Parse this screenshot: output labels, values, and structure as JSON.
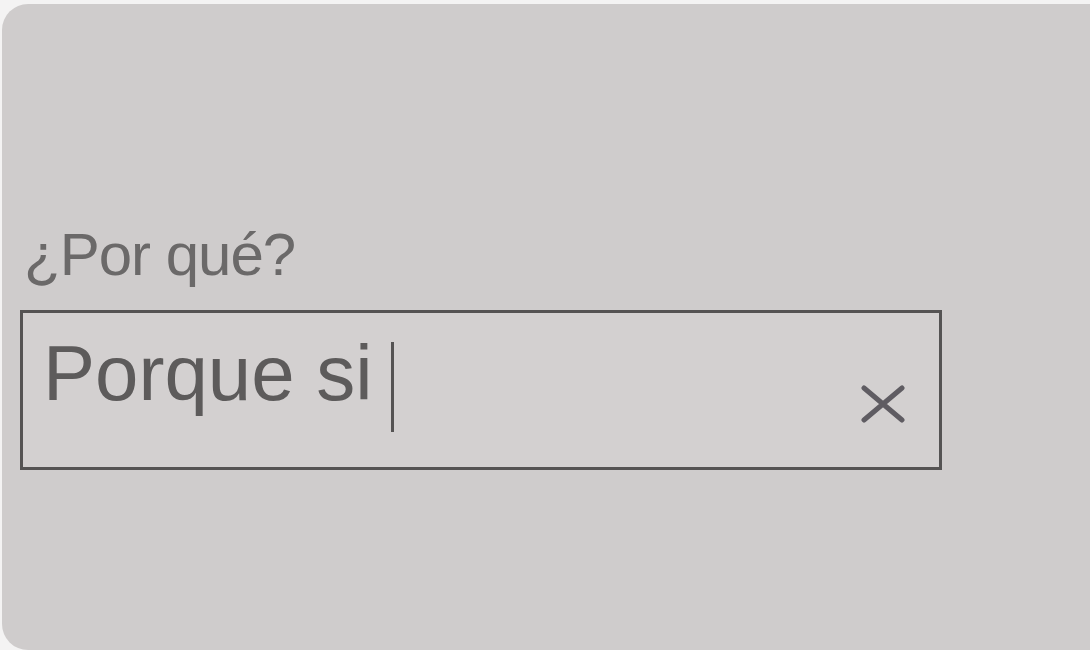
{
  "question": {
    "label": "¿Por qué?"
  },
  "answer_field": {
    "value": "Porque si",
    "focused": true
  }
}
